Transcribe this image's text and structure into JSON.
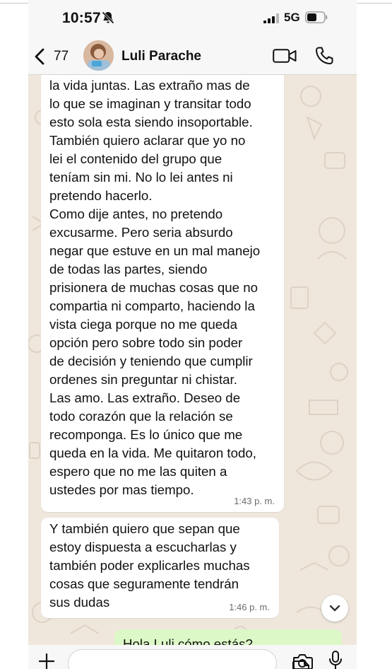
{
  "status_bar": {
    "time": "10:57",
    "network": "5G",
    "icons": [
      "bell-off-icon",
      "signal-icon",
      "battery-icon"
    ]
  },
  "header": {
    "back_count": "77",
    "contact_name": "Luli Parache",
    "icons": [
      "back-chevron-icon",
      "video-call-icon",
      "phone-call-icon"
    ]
  },
  "messages": [
    {
      "direction": "incoming",
      "text": "volver a estar a su lado y compartir\nla vida juntas. Las extraño mas de\nlo que se imaginan y transitar todo\nesto sola esta siendo insoportable.\nTambién quiero aclarar que yo no\nlei el contenido del grupo que\nteníam sin mi. No lo lei antes ni\npretendo hacerlo.\nComo dije antes, no pretendo\nexcusarme. Pero seria absurdo\nnegar que estuve en un mal manejo\nde todas las partes, siendo\nprisionera de muchas cosas que no\ncompartia ni comparto, haciendo la\nvista ciega porque no me queda\nopción pero sobre todo sin poder\nde decisión y teniendo que cumplir\nordenes sin preguntar ni chistar.\nLas amo. Las extraño. Deseo de\ntodo corazón que la relación se\nrecomponga. Es lo único que me\nqueda en la vida. Me quitaron todo,\nespero que no me las quiten a\nustedes por mas tiempo.",
      "time": "1:43 p. m."
    },
    {
      "direction": "incoming",
      "text": "Y también quiero que sepan que\nestoy dispuesta a escucharlas y\ntambién poder explicarles muchas\ncosas que seguramente tendrán\nsus dudas",
      "time": "1:46 p. m."
    },
    {
      "direction": "outgoing",
      "text": "Hola Luli cómo estás?"
    }
  ],
  "input_bar": {
    "placeholder": "",
    "icons": [
      "plus-icon",
      "sticker-icon",
      "camera-icon",
      "mic-icon"
    ]
  },
  "colors": {
    "wallpaper": "#efe7dc",
    "incoming_bubble": "#ffffff",
    "outgoing_bubble": "#dcf8c6",
    "bars": "#f7f7f7"
  }
}
